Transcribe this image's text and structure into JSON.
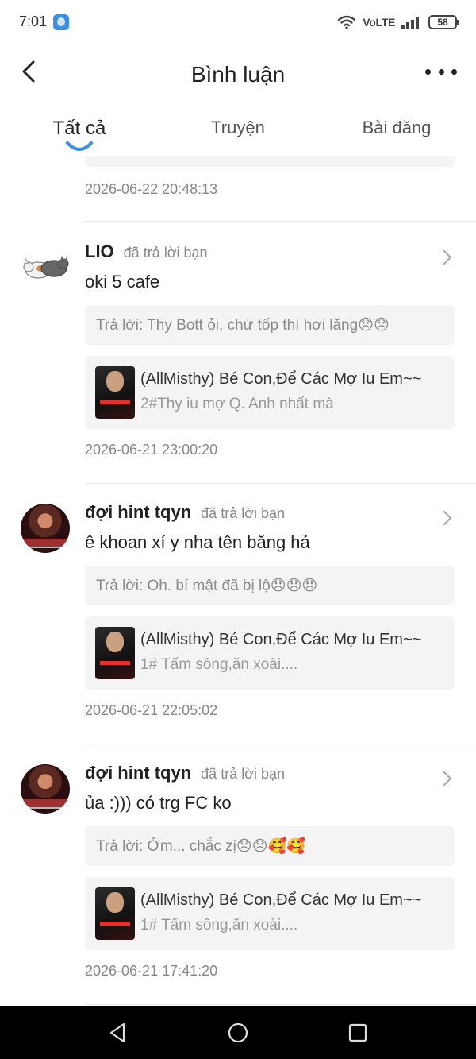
{
  "status_bar": {
    "time": "7:01",
    "network": "VoLTE",
    "battery": "58"
  },
  "header": {
    "title": "Bình luận"
  },
  "tabs": [
    {
      "label": "Tất cả",
      "active": true
    },
    {
      "label": "Truyện",
      "active": false
    },
    {
      "label": "Bài đăng",
      "active": false
    }
  ],
  "colors": {
    "accent": "#3a8ee6",
    "muted_text": "#888888",
    "box_bg": "#f4f4f4"
  },
  "first_timestamp": "2026-06-22 20:48:13",
  "comments": [
    {
      "username": "LIO",
      "action": "đã trả lời bạn",
      "text": "oki 5 cafe",
      "reply": "Trả lời: Thy Bott ỏi, chứ tốp thì hơi lăng😞😞",
      "story_title": "(AllMisthy) Bé Con,Để Các Mợ Iu Em~~",
      "story_chapter": "2#Thy iu mợ Q. Anh nhất mà",
      "timestamp": "2026-06-21 23:00:20",
      "avatar": "cat-avatar"
    },
    {
      "username": "đợi hint tqyn",
      "action": "đã trả lời bạn",
      "text": "ê khoan xí y nha tên băng hả",
      "reply": "Trả lời: Oh. bí mật đã bị lộ😞😞😞",
      "story_title": "(AllMisthy) Bé Con,Để Các Mợ Iu Em~~",
      "story_chapter": "1# Tấm sông,ăn xoài....",
      "timestamp": "2026-06-21 22:05:02",
      "avatar": "photo-avatar"
    },
    {
      "username": "đợi hint tqyn",
      "action": "đã trả lời bạn",
      "text": "ủa :))) có trg FC ko",
      "reply": "Trả lời: Ởm... chắc zị😞😞🥰🥰",
      "story_title": "(AllMisthy) Bé Con,Để Các Mợ Iu Em~~",
      "story_chapter": "1# Tấm sông,ăn xoài....",
      "timestamp": "2026-06-21 17:41:20",
      "avatar": "photo-avatar"
    }
  ]
}
